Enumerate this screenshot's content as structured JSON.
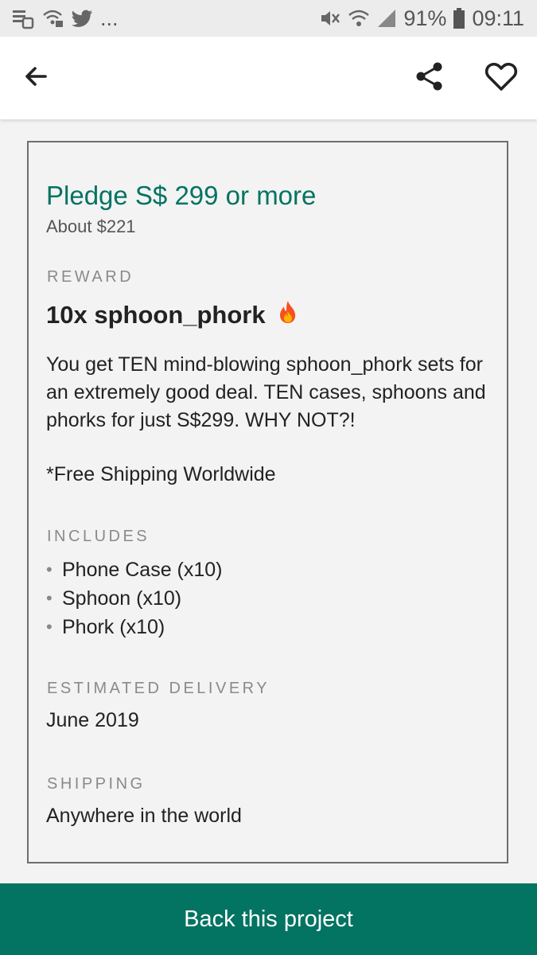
{
  "status_bar": {
    "left_icons": [
      "notification-stack-icon",
      "wifi-lock-icon",
      "twitter-icon"
    ],
    "overflow_text": "...",
    "battery_percent": "91%",
    "time": "09:11",
    "right_icons": [
      "mute-icon",
      "wifi-icon",
      "signal-icon",
      "battery-icon"
    ]
  },
  "toolbar": {
    "back_icon": "arrow-left-icon",
    "share_icon": "share-icon",
    "favorite_icon": "heart-outline-icon"
  },
  "reward_card": {
    "pledge": "Pledge S$ 299 or more",
    "pledge_converted": "About $221",
    "reward_label": "REWARD",
    "reward_title": "10x sphoon_phork",
    "reward_emoji": "fire-icon",
    "description": "You get TEN mind-blowing sphoon_phork sets for an extremely good deal. TEN cases, sphoons and phorks for just S$299. WHY NOT?!",
    "shipping_note": "*Free Shipping Worldwide",
    "includes_label": "INCLUDES",
    "includes": [
      "Phone Case (x10)",
      "Sphoon (x10)",
      "Phork (x10)"
    ],
    "delivery_label": "ESTIMATED DELIVERY",
    "delivery_value": "June 2019",
    "shipping_label": "SHIPPING",
    "shipping_value": "Anywhere in the world"
  },
  "cta": {
    "label": "Back this project"
  },
  "colors": {
    "brand_green": "#037362",
    "status_bar_bg": "#ececec",
    "card_border": "#6e6e6e"
  }
}
